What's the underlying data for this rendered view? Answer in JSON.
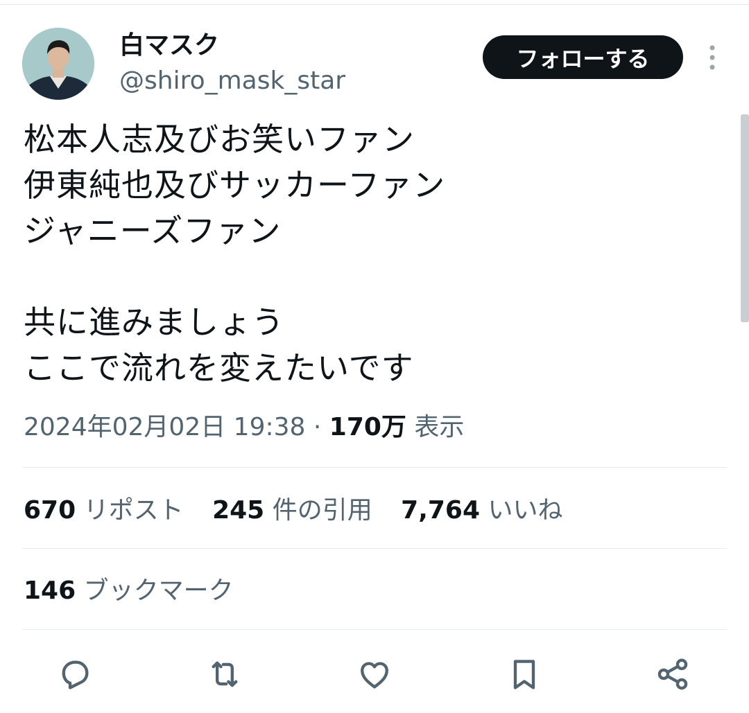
{
  "profile": {
    "display_name": "白マスク",
    "handle": "@shiro_mask_star",
    "follow_label": "フォローする"
  },
  "tweet": {
    "lines": [
      "松本人志及びお笑いファン",
      "伊東純也及びサッカーファン",
      "ジャニーズファン",
      "",
      "共に進みましょう",
      "ここで流れを変えたいです"
    ]
  },
  "meta": {
    "timestamp": "2024年02月02日 19:38",
    "separator": " · ",
    "views_count": "170万",
    "views_label": " 表示"
  },
  "stats": {
    "reposts": {
      "count": "670",
      "label": "リポスト"
    },
    "quotes": {
      "count": "245",
      "label": "件の引用"
    },
    "likes": {
      "count": "7,764",
      "label": "いいね"
    },
    "bookmarks": {
      "count": "146",
      "label": "ブックマーク"
    }
  },
  "actions": [
    {
      "icon": "reply-icon"
    },
    {
      "icon": "repost-icon"
    },
    {
      "icon": "like-icon"
    },
    {
      "icon": "bookmark-icon"
    },
    {
      "icon": "share-icon"
    }
  ],
  "colors": {
    "text": "#0f1419",
    "secondary": "#536471",
    "divider": "#e6ebee",
    "button": "#0f1419"
  }
}
